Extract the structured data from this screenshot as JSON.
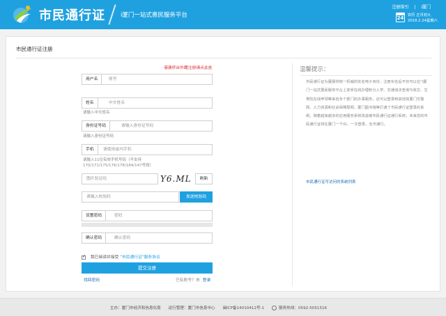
{
  "header": {
    "brand": "市民通行证",
    "slogan": "i厦门一站式惠民服务平台",
    "links": [
      "注册指引",
      "i厦门"
    ],
    "weekday_line": "农历 正月初九",
    "date_line": "2018.2.24星期六",
    "calendar_day": "24"
  },
  "form": {
    "title": "市民通行证注册",
    "notice": "港澳侨台外籍注册请点此处",
    "username": {
      "label": "用户名",
      "placeholder": "账号"
    },
    "realname": {
      "label": "姓名",
      "placeholder": "中文姓名",
      "hint": "请输入中文姓名"
    },
    "idcard": {
      "label": "身份证号码",
      "placeholder": "请输入身份证号码",
      "hint": "请输入身份证号码"
    },
    "phone": {
      "label": "手机",
      "placeholder": "请使用省内手机",
      "hint": "请输入11位有效手机号码（不支持170/171/175/176/178/184/147号段）"
    },
    "captcha": {
      "placeholder": "图片验证码",
      "image_text": "Y6.ML",
      "refresh": "刷新"
    },
    "sms": {
      "placeholder": "请输入校验码",
      "send": "发送校验码"
    },
    "password": {
      "label": "设置密码",
      "placeholder": "密码"
    },
    "confirm": {
      "label": "确认密码",
      "placeholder": "确认密码"
    },
    "agree_prefix": "我已阅读并接受",
    "agree_link": "\"市民通行证\"服务协议",
    "submit": "提交注册",
    "retrieve": "找回密码",
    "have_account": "已有账号？去",
    "login": "登录"
  },
  "tips": {
    "title": "温馨提示：",
    "body": "市民通行证为厦服供统一权威的实名电子身份，注册实名后不仅可以在\"i厦门一站式惠民服务平台上享受在线办理积分入学、交通违法查询与收文、生育险在线申领等来自多个部门的办事服务，还可以登录到其他如厦门交警网、人力资源和社会保障局网、厦门图书馆等打通了市民通行证登录的系统。随着越来越多的应用服务系统改造使市民通行证通行系统，未来您的市民通行证将在厦门一个ID，一次登录，全市通行。",
    "link": "市民通行证可访问的系统列表"
  },
  "footer": {
    "sponsor": "主办：厦门市经济和信息化局",
    "operator": "运行管理：厦门市信息中心",
    "icp": "闽ICP备14010412号-1",
    "hotline": "服务热线：0592-5051516"
  }
}
